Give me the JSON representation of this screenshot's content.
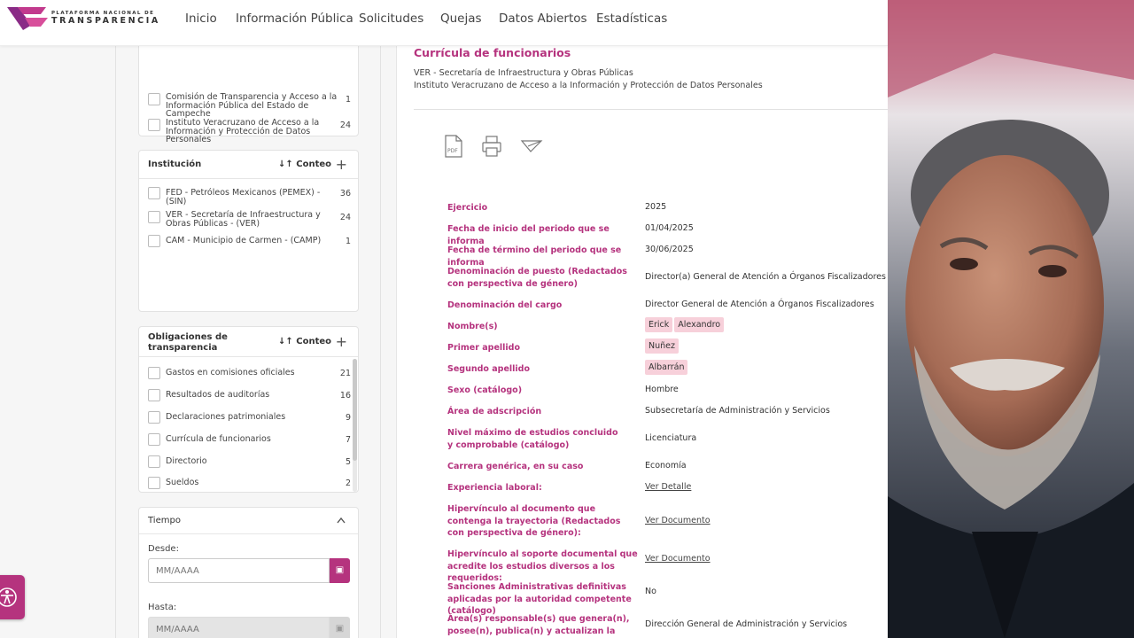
{
  "header": {
    "logo_small": "PLATAFORMA NACIONAL DE",
    "logo_big": "TRANSPARENCIA",
    "nav": [
      "Inicio",
      "Información Pública",
      "Solicitudes",
      "Quejas",
      "Datos Abiertos",
      "Estadísticas"
    ]
  },
  "sidebar": {
    "organismos": [
      {
        "label": "Comisión de Transparencia y Acceso a la Información Pública del Estado de Campeche",
        "count": "1"
      },
      {
        "label": "Instituto Veracruzano de Acceso a la Información y Protección de Datos Personales",
        "count": "24"
      }
    ],
    "institucion": {
      "title": "Institución",
      "sort": "Conteo",
      "items": [
        {
          "label": "FED - Petróleos Mexicanos (PEMEX) - (SIN)",
          "count": "36"
        },
        {
          "label": "VER - Secretaría de Infraestructura y Obras Públicas - (VER)",
          "count": "24"
        },
        {
          "label": "CAM - Municipio de Carmen - (CAMP)",
          "count": "1"
        }
      ]
    },
    "obligaciones": {
      "title": "Obligaciones de transparencia",
      "sort": "Conteo",
      "items": [
        {
          "label": "Gastos en comisiones oficiales",
          "count": "21"
        },
        {
          "label": "Resultados de auditorías",
          "count": "16"
        },
        {
          "label": "Declaraciones patrimoniales",
          "count": "9"
        },
        {
          "label": "Currícula de funcionarios",
          "count": "7"
        },
        {
          "label": "Directorio",
          "count": "5"
        },
        {
          "label": "Sueldos",
          "count": "2"
        }
      ]
    },
    "tiempo": {
      "title": "Tiempo",
      "desde_label": "Desde:",
      "hasta_label": "Hasta:",
      "placeholder": "MM/AAAA"
    }
  },
  "main": {
    "title": "Currícula de funcionarios",
    "subtitle1": "VER - Secretaría de Infraestructura y Obras Públicas",
    "subtitle2": "Instituto Veracruzano de Acceso a la Información y Protección de Datos Personales",
    "pdf_text": "PDF",
    "fields": {
      "ejercicio": {
        "label": "Ejercicio",
        "value": "2025"
      },
      "inicio": {
        "label": "Fecha de inicio del periodo que se informa",
        "value": "01/04/2025"
      },
      "termino": {
        "label": "Fecha de término del periodo que se informa",
        "value": "30/06/2025"
      },
      "puesto": {
        "label": "Denominación de puesto (Redactados con perspectiva de género)",
        "value": "Director(a) General de Atención a Órganos Fiscalizadores"
      },
      "cargo": {
        "label": "Denominación del cargo",
        "value": "Director General de Atención a Órganos Fiscalizadores"
      },
      "nombre": {
        "label": "Nombre(s)",
        "value1": "Erick",
        "value2": "Alexandro"
      },
      "primer": {
        "label": "Primer apellido",
        "value": "Nuñez"
      },
      "segundo": {
        "label": "Segundo apellido",
        "value": "Albarrán"
      },
      "sexo": {
        "label": "Sexo (catálogo)",
        "value": "Hombre"
      },
      "area": {
        "label": "Área de adscripción",
        "value": "Subsecretaría de Administración y Servicios"
      },
      "nivel": {
        "label": "Nivel máximo de estudios concluido y comprobable (catálogo)",
        "value": "Licenciatura"
      },
      "carrera": {
        "label": "Carrera genérica, en su caso",
        "value": "Economía"
      },
      "experiencia": {
        "label": "Experiencia laboral:",
        "value": "Ver Detalle"
      },
      "hiper1": {
        "label": "Hipervínculo al documento que contenga la trayectoria (Redactados con perspectiva de género):",
        "value": "Ver Documento"
      },
      "hiper2": {
        "label": "Hipervínculo al soporte documental que acredite los estudios diversos a los requeridos:",
        "value": "Ver Documento"
      },
      "sanciones": {
        "label": "Sanciones Administrativas definitivas aplicadas por la autoridad competente (catálogo)",
        "value": "No"
      },
      "responsables": {
        "label": "Área(s) responsable(s) que genera(n), posee(n), publica(n) y actualizan la información",
        "value": "Dirección General de Administración y Servicios"
      }
    }
  },
  "colors": {
    "accent": "#b5337e",
    "chip": "#f7d0da"
  }
}
